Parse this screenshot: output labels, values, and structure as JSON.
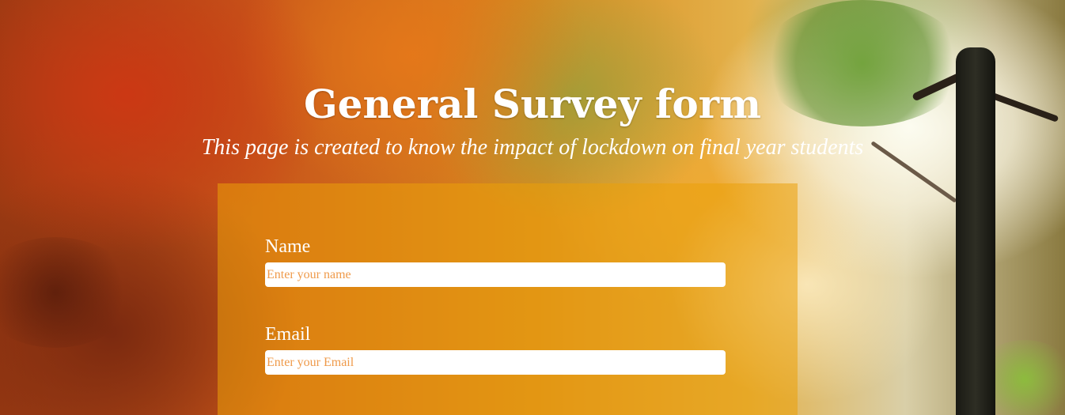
{
  "header": {
    "title": "General Survey form",
    "subtitle": "This page is created to know the impact of lockdown on final year students"
  },
  "form": {
    "name": {
      "label": "Name",
      "placeholder": "Enter your name",
      "value": ""
    },
    "email": {
      "label": "Email",
      "placeholder": "Enter your Email",
      "value": ""
    }
  },
  "colors": {
    "text": "#ffffff",
    "panel": "#eba00a",
    "placeholder": "#ef9a4a"
  }
}
